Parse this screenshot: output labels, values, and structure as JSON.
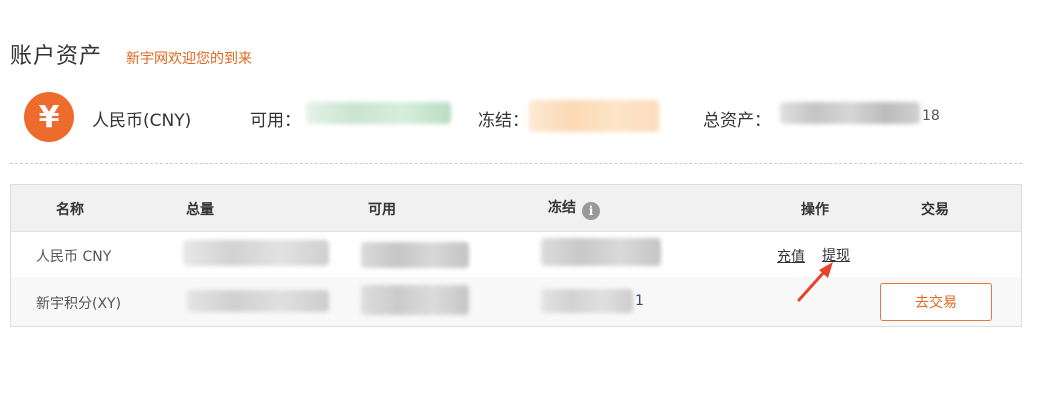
{
  "header": {
    "title": "账户资产",
    "welcome": "新宇网欢迎您的到来"
  },
  "summary": {
    "currency_icon": "yen-icon",
    "currency_name": "人民币(CNY)",
    "available_label": "可用：",
    "frozen_label": "冻结：",
    "total_label": "总资产：",
    "total_visible_tail": "18"
  },
  "table": {
    "headers": {
      "name": "名称",
      "total": "总量",
      "available": "可用",
      "frozen": "冻结",
      "operation": "操作",
      "trade": "交易"
    },
    "rows": [
      {
        "name": "人民币 CNY",
        "recharge_label": "充值",
        "withdraw_label": "提现"
      },
      {
        "name": "新宇积分(XY)",
        "frozen_visible_tail": "1",
        "trade_button_label": "去交易"
      }
    ]
  },
  "colors": {
    "accent": "#e0661e",
    "icon_bg": "#ec6b2d",
    "arrow": "#e8412c"
  }
}
